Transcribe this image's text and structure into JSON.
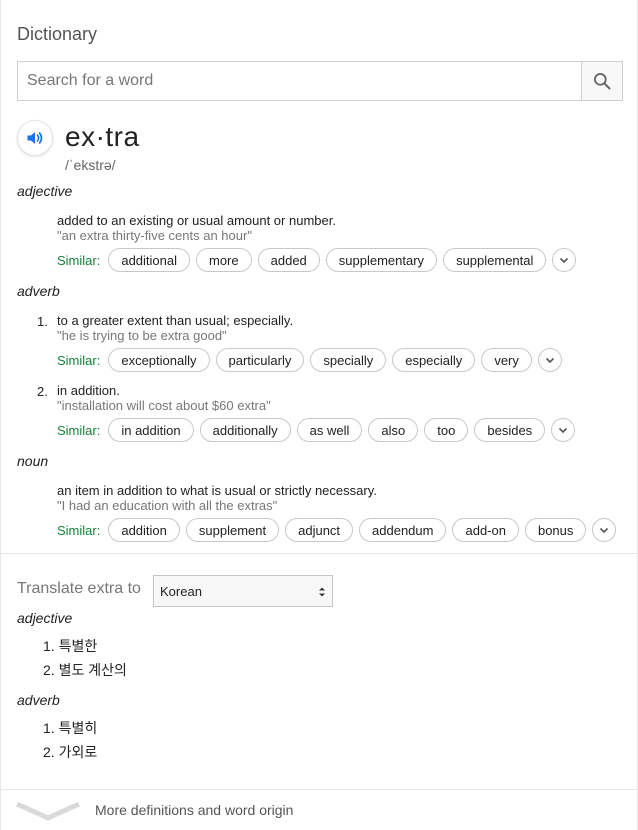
{
  "header": {
    "title": "Dictionary"
  },
  "search": {
    "placeholder": "Search for a word"
  },
  "entry": {
    "word": "ex·tra",
    "phonetic": "/ˈekstrə/"
  },
  "senses": {
    "adjective": {
      "pos": "adjective",
      "def1": {
        "definition": "added to an existing or usual amount or number.",
        "example": "\"an extra thirty-five cents an hour\"",
        "similar_label": "Similar:",
        "similar": [
          "additional",
          "more",
          "added",
          "supplementary",
          "supplemental"
        ]
      }
    },
    "adverb": {
      "pos": "adverb",
      "def1": {
        "number": "1.",
        "definition": "to a greater extent than usual; especially.",
        "example": "\"he is trying to be extra good\"",
        "similar_label": "Similar:",
        "similar": [
          "exceptionally",
          "particularly",
          "specially",
          "especially",
          "very"
        ]
      },
      "def2": {
        "number": "2.",
        "definition": "in addition.",
        "example": "\"installation will cost about $60 extra\"",
        "similar_label": "Similar:",
        "similar": [
          "in addition",
          "additionally",
          "as well",
          "also",
          "too",
          "besides"
        ]
      }
    },
    "noun": {
      "pos": "noun",
      "def1": {
        "definition": "an item in addition to what is usual or strictly necessary.",
        "example": "\"I had an education with all the extras\"",
        "similar_label": "Similar:",
        "similar": [
          "addition",
          "supplement",
          "adjunct",
          "addendum",
          "add-on",
          "bonus"
        ]
      }
    }
  },
  "translate": {
    "label": "Translate extra to",
    "language": "Korean",
    "adjective": {
      "pos": "adjective",
      "items": [
        "1. 특별한",
        "2. 별도 계산의"
      ]
    },
    "adverb": {
      "pos": "adverb",
      "items": [
        "1. 특별히",
        "2. 가외로"
      ]
    }
  },
  "footer": {
    "more_label": "More definitions and word origin"
  },
  "colors": {
    "similar_green": "#188038",
    "speaker_blue": "#1a73e8"
  },
  "icons": {
    "search": "search-icon",
    "speaker": "speaker-icon",
    "expand": "chevron-down-icon"
  }
}
